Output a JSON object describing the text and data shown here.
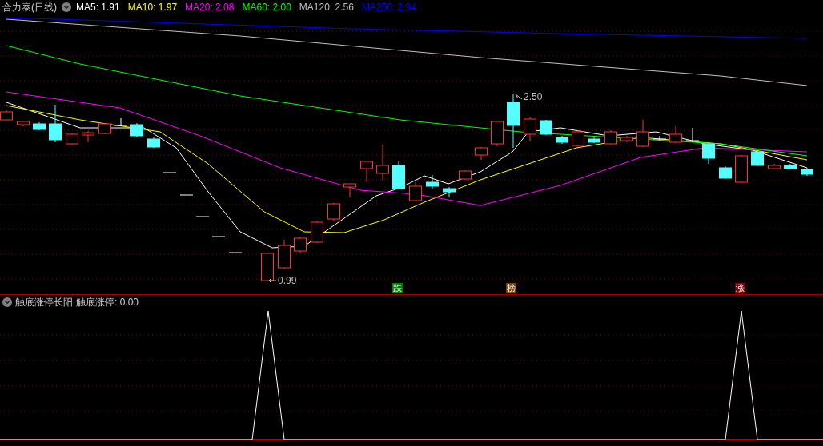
{
  "header": {
    "title": "合力泰(日线)",
    "indicators": [
      {
        "label": "MA5: 1.91",
        "color": "#ffffff"
      },
      {
        "label": "MA10: 1.97",
        "color": "#ffff00"
      },
      {
        "label": "MA20: 2.08",
        "color": "#ff00ff"
      },
      {
        "label": "MA60: 2.00",
        "color": "#00ff00"
      },
      {
        "label": "MA120: 2.56",
        "color": "#c0c0c0"
      },
      {
        "label": "MA250: 2.94",
        "color": "#0000ff"
      }
    ]
  },
  "chart": {
    "high_label": "2.50",
    "low_label": "0.99",
    "markers": [
      {
        "label": "跌",
        "color": "#008000"
      },
      {
        "label": "榜",
        "color": "#804000"
      },
      {
        "label": "涨",
        "color": "#800000"
      }
    ]
  },
  "indicator_panel": {
    "title": "触底涨停长阳",
    "reading": "触底涨停: 0.00"
  }
}
